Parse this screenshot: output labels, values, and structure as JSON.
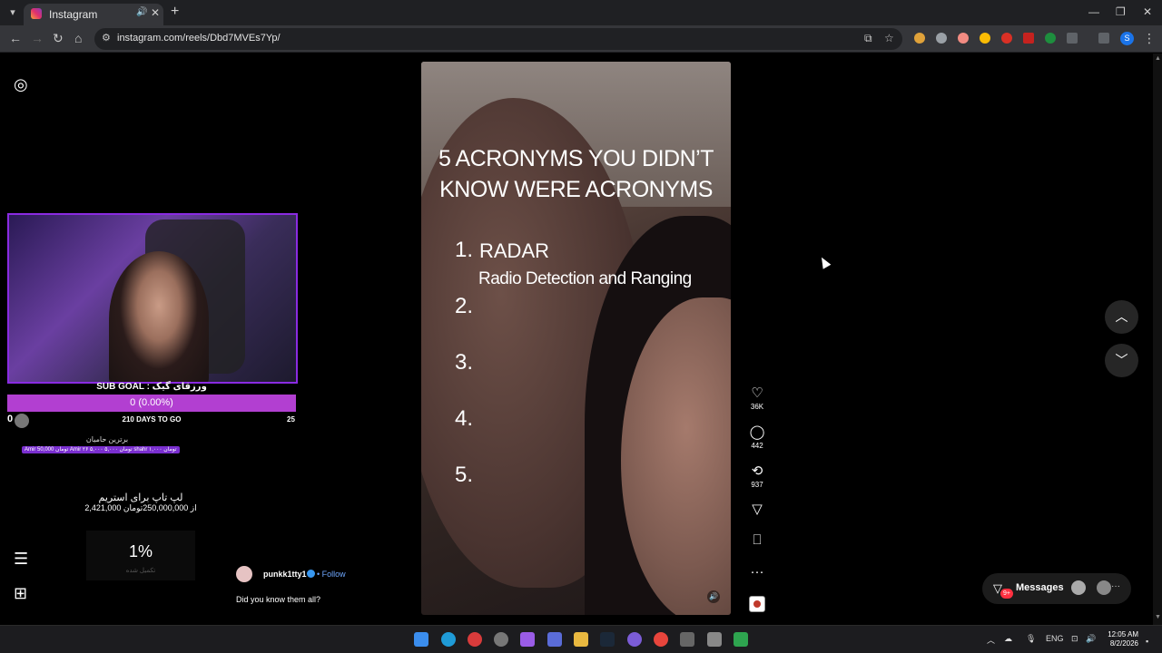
{
  "browser": {
    "tab_title": "Instagram",
    "url": "instagram.com/reels/Dbd7MVEs7Yp/",
    "profile_initial": "S"
  },
  "stream": {
    "sub_goal": "SUB GOAL : ورزقای گیک",
    "goal_value": "0 (0.00%)",
    "goal_start": "0",
    "days_to_go": "210 DAYS TO GO",
    "goal_target": "25",
    "donors_title": "برترین حامیان",
    "donors_row": "Amir  50,000 تومان   Amir ۲۶  ۵,۰۰۰ تومان   ۵,۰۰۰  shahr  ۱,۰۰۰ تومان",
    "laptop_title": "لپ تاپ برای استریم",
    "laptop_amount": "2,421,000 از 250,000,000تومان",
    "progress_pct": "1%",
    "progress_sub": "تکمیل شده"
  },
  "reel": {
    "title": "5 ACRONYMS YOU DIDN’T KNOW WERE ACRONYMS",
    "numbers": [
      "1.",
      "2.",
      "3.",
      "4.",
      "5."
    ],
    "item1": "RADAR",
    "item1_sub": "Radio Detection and Ranging",
    "author": "punkk1tty1",
    "follow": "• Follow",
    "caption": "Did you know them all?",
    "likes": "36K",
    "comments": "442",
    "reposts": "937"
  },
  "messages": {
    "label": "Messages",
    "badge": "9+"
  },
  "taskbar": {
    "lang": "ENG",
    "time": "12:05 AM",
    "date": "8/2/2026"
  }
}
